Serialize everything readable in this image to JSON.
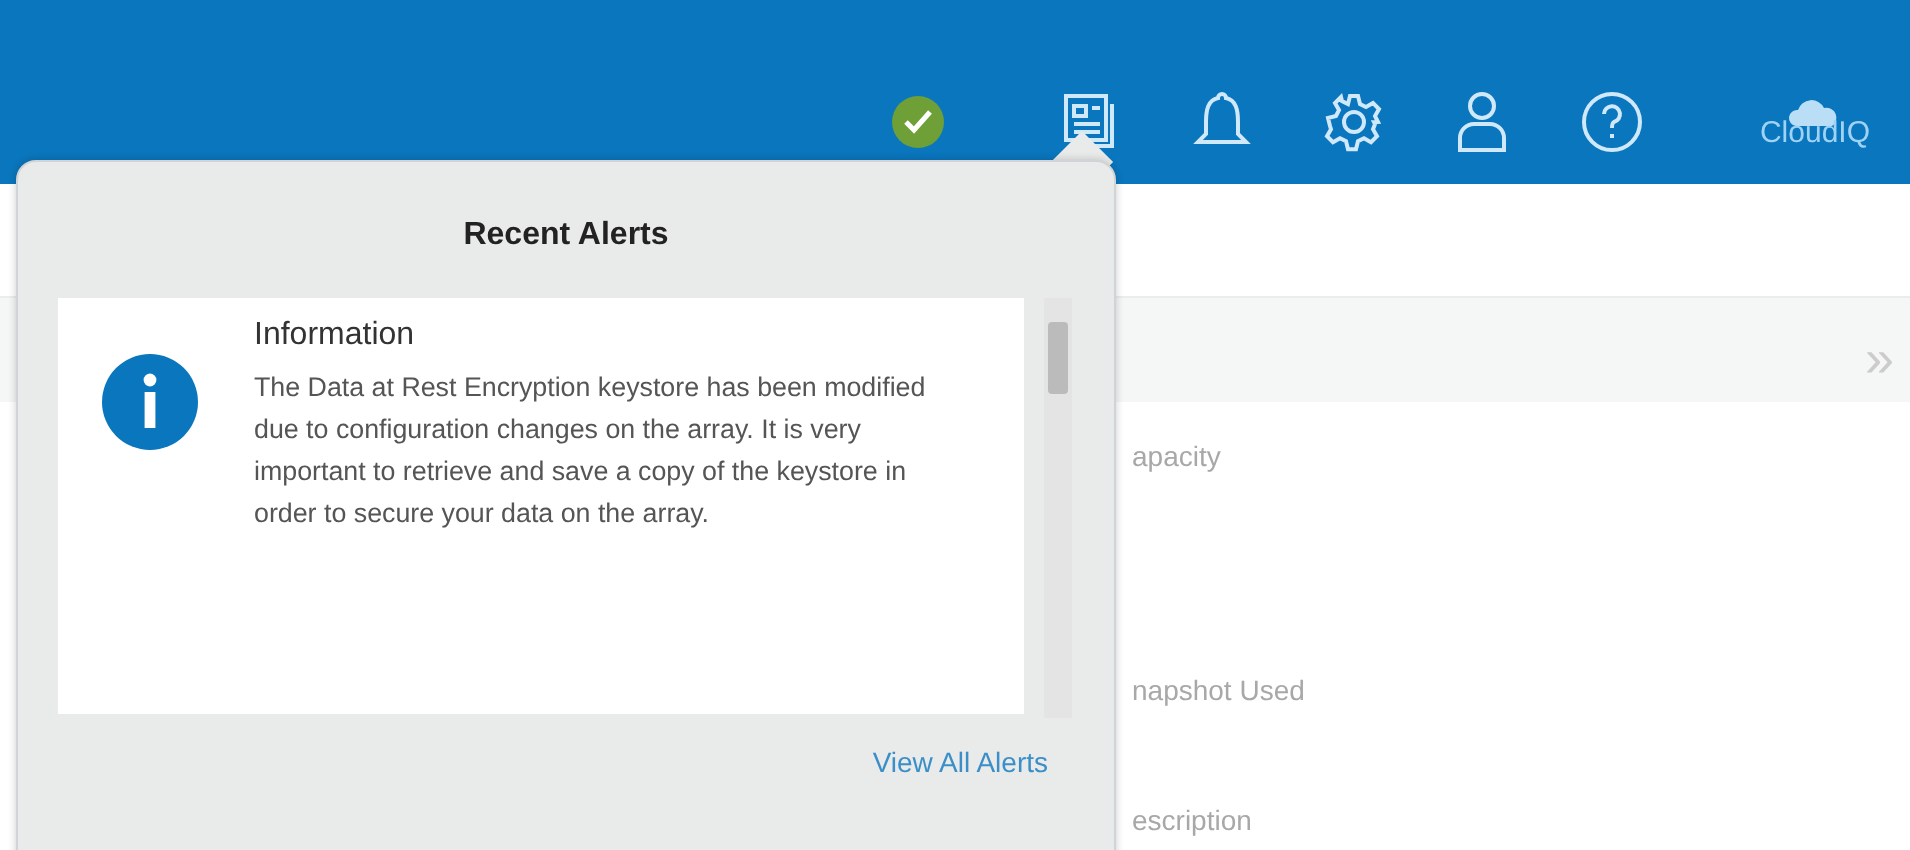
{
  "header": {
    "logo": "CloudIQ",
    "status_ok": true
  },
  "background": {
    "expand": "»",
    "labels": [
      "apacity",
      "napshot Used",
      "escription"
    ]
  },
  "alerts_popup": {
    "title": "Recent Alerts",
    "alerts": [
      {
        "kind": "info",
        "title": "Information",
        "message": "The Data at Rest Encryption keystore has been modified due to configuration changes on the array. It is very important to retrieve and save a copy of the keystore in order to secure your data on the array."
      }
    ],
    "link": "View All Alerts"
  }
}
